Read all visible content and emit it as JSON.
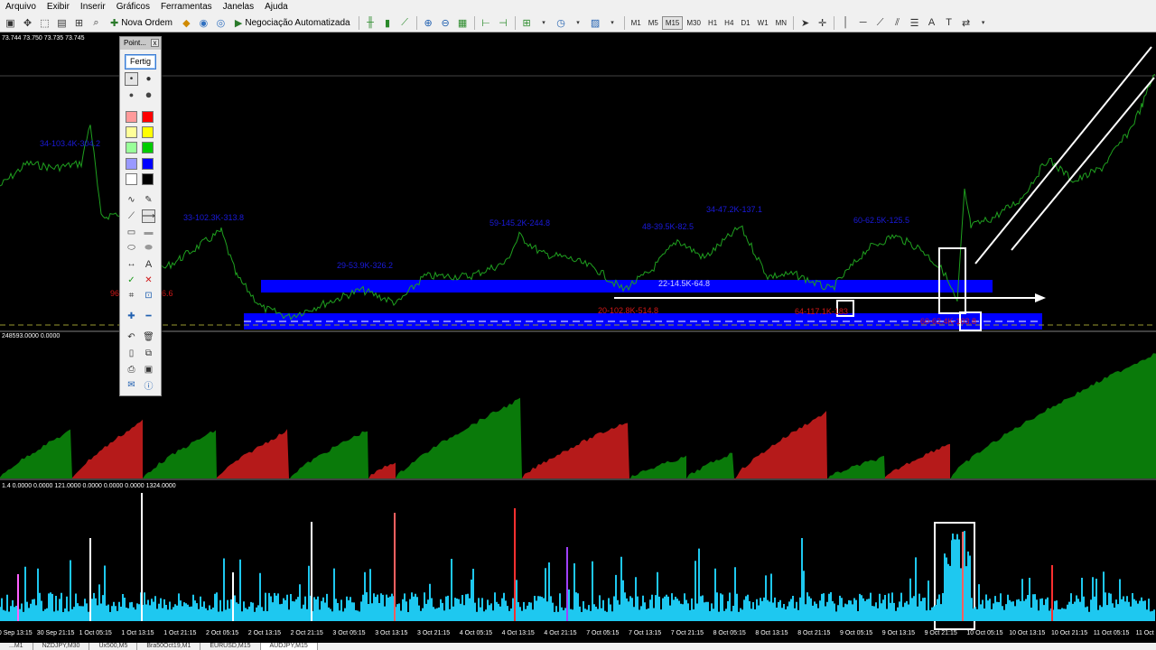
{
  "menu": [
    "Arquivo",
    "Exibir",
    "Inserir",
    "Gráficos",
    "Ferramentas",
    "Janelas",
    "Ajuda"
  ],
  "toolbar": {
    "new_order": "Nova Ordem",
    "auto_trading": "Negociação Automatizada",
    "timeframes": [
      "M1",
      "M5",
      "M15",
      "M30",
      "H1",
      "H4",
      "D1",
      "W1",
      "MN"
    ],
    "active_timeframe": "M15",
    "text_tool": "A",
    "tool_icons": [
      "new-chart-icon",
      "profiles-icon",
      "zoom-window-icon",
      "market-watch-icon",
      "data-window-icon",
      "navigator-icon",
      "terminal-icon",
      "tester-icon",
      "metaeditor-icon",
      "signals-icon",
      "bar-chart-icon",
      "candlestick-icon",
      "line-chart-icon",
      "zoom-in-icon",
      "zoom-out-icon",
      "tile-icon",
      "autoscroll-icon",
      "shift-icon",
      "indicators-icon",
      "period-icon",
      "template-icon",
      "cursor-icon",
      "crosshair-icon",
      "vertical-line-icon",
      "horizontal-line-icon",
      "trendline-icon",
      "channel-icon",
      "fibonacci-icon",
      "text-label-icon",
      "arrows-icon"
    ]
  },
  "chart": {
    "ohlc": "73.744 73.750 73.735 73.745",
    "indicator1_header": "248593.0000 0.0000",
    "indicator2_header": "1.4 0.0000 0.0000 121.0000 0.0000 0.0000 0.0000 1324.0000",
    "blue_labels": [
      {
        "text": "34-103.4K-304.2"
      },
      {
        "text": "33-102.3K-313.8"
      },
      {
        "text": "29-53.9K-326.2"
      },
      {
        "text": "59-145.2K-244.8"
      },
      {
        "text": "48-39.5K-82.5"
      },
      {
        "text": "34-47.2K-137.1"
      },
      {
        "text": "60-62.5K-125.5"
      },
      {
        "text": "22-14.5K-64.8"
      }
    ],
    "red_labels": [
      {
        "text": "96-"
      },
      {
        "text": "-6.6"
      },
      {
        "text": "20-102.8K-514.8"
      },
      {
        "text": "64-117.1K-183"
      },
      {
        "text": "60-62.4K-103.8"
      }
    ],
    "x_ticks": [
      "30 Sep 13:15",
      "30 Sep 21:15",
      "1 Oct 05:15",
      "1 Oct 13:15",
      "1 Oct 21:15",
      "2 Oct 05:15",
      "2 Oct 13:15",
      "2 Oct 21:15",
      "3 Oct 05:15",
      "3 Oct 13:15",
      "3 Oct 21:15",
      "4 Oct 05:15",
      "4 Oct 13:15",
      "4 Oct 21:15",
      "7 Oct 05:15",
      "7 Oct 13:15",
      "7 Oct 21:15",
      "8 Oct 05:15",
      "8 Oct 13:15",
      "8 Oct 21:15",
      "9 Oct 05:15",
      "9 Oct 13:15",
      "9 Oct 21:15",
      "10 Oct 05:15",
      "10 Oct 13:15",
      "10 Oct 21:15",
      "11 Oct 05:15",
      "11 Oct 13:15",
      "11 Oct"
    ],
    "colors": {
      "price": "#1fa01f",
      "zone": "#0000ff",
      "bull": "#0a7a0a",
      "bear": "#b51a1a",
      "volume": "#1ec8f0",
      "annot": "#ffffff"
    }
  },
  "palette": {
    "title": "Point...",
    "close": "x",
    "button": "Fertig",
    "text_tool": "A",
    "colors": [
      "#ff9a9a",
      "#ff0000",
      "#ffff99",
      "#ffff00",
      "#99ff99",
      "#00cc00",
      "#9999ff",
      "#0000ff",
      "#ffffff",
      "#000000"
    ]
  },
  "tabs": [
    "...M1",
    "NZDJPY,M30",
    "Ux500,M5",
    "Bra50Oct19,M1",
    "EURUSD,M15",
    "AUDJPY,M15"
  ],
  "active_tab": "AUDJPY,M15"
}
